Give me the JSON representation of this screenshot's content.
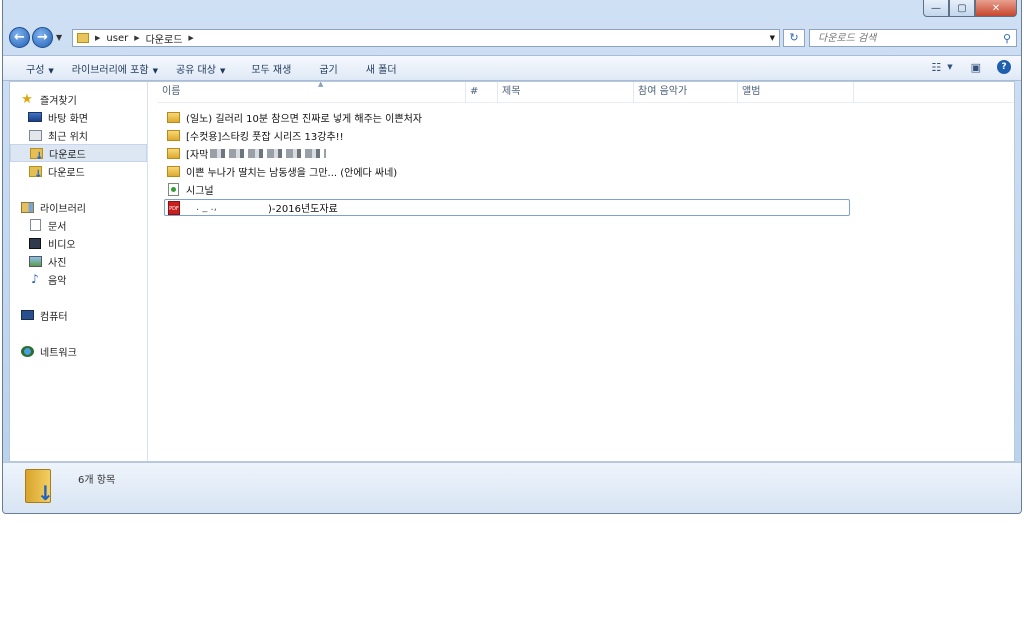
{
  "window": {
    "controls": {
      "minimize": "—",
      "maximize": "▢",
      "close": "✕"
    }
  },
  "nav": {
    "back_icon": "back-arrow-icon",
    "forward_icon": "forward-arrow-icon",
    "address": [
      "user",
      "다운로드"
    ],
    "search_placeholder": "다운로드 검색"
  },
  "toolbar": {
    "organize": "구성",
    "include_library": "라이브러리에 포함",
    "share": "공유 대상",
    "play_all": "모두 재생",
    "burn": "굽기",
    "new_folder": "새 폴더"
  },
  "sidebar": {
    "favorites": "즐겨찾기",
    "desktop": "바탕 화면",
    "recent": "최근 위치",
    "downloads_1": "다운로드",
    "downloads_2": "다운로드",
    "libraries": "라이브러리",
    "documents": "문서",
    "videos": "비디오",
    "pictures": "사진",
    "music": "음악",
    "computer": "컴퓨터",
    "network": "네트워크"
  },
  "columns": {
    "name": "이름",
    "number": "#",
    "title": "제목",
    "artist": "참여 음악가",
    "album": "앨범"
  },
  "files": {
    "f1": "(일노) 길러리 10분 참으면 진짜로 넣게 해주는 이쁜처자",
    "f2": "[수컷용]스타킹 풋잡 시리즈 13강추!!",
    "f3": "[자막",
    "f4": "이쁜 누나가 딸치는 남동생을 그만... (안에다 싸네)",
    "f5": "시그널",
    "f6_prefix": ".  _  .,",
    "f6": ")-2016년도자료"
  },
  "status": {
    "count": "6개 항목"
  }
}
